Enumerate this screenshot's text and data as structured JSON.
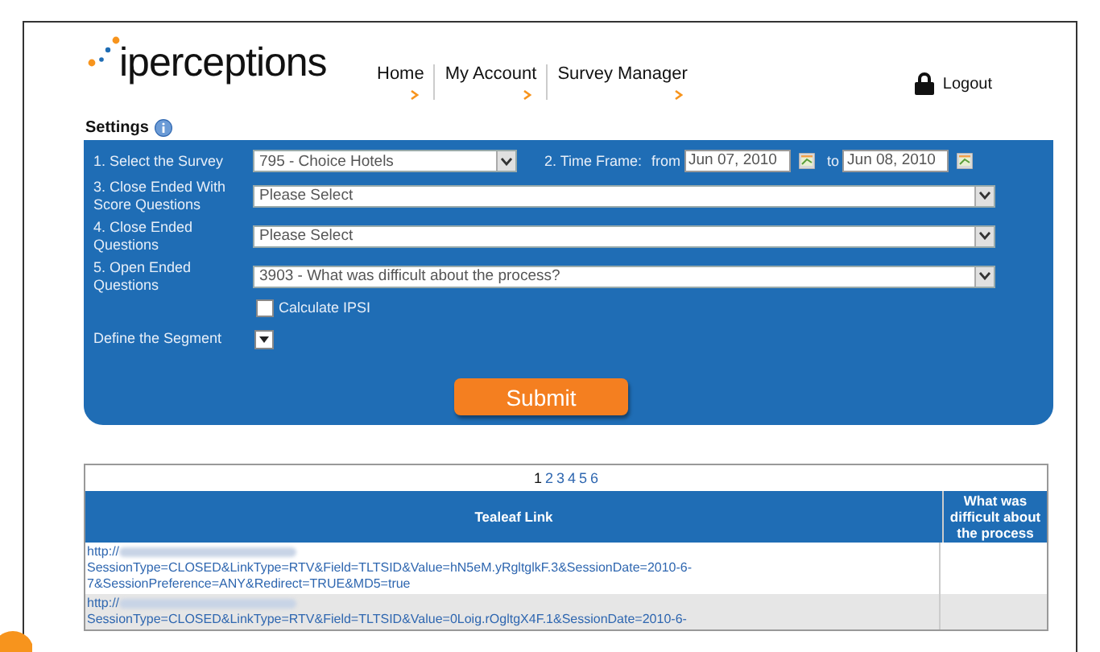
{
  "logo": {
    "text": "iperceptions"
  },
  "nav": [
    {
      "label": "Home"
    },
    {
      "label": "My Account"
    },
    {
      "label": "Survey Manager"
    }
  ],
  "logout": {
    "label": "Logout"
  },
  "settings": {
    "title": "Settings"
  },
  "form": {
    "survey_label": "1. Select the Survey",
    "survey_value": "795 - Choice Hotels",
    "time_frame_label": "2. Time Frame:",
    "from_label": "from",
    "from_value": "Jun 07, 2010",
    "to_label": "to",
    "to_value": "Jun 08, 2010",
    "selects": [
      {
        "label": "3. Close Ended With Score Questions",
        "value": "Please Select"
      },
      {
        "label": "4. Close Ended Questions",
        "value": "Please Select"
      },
      {
        "label": "5. Open Ended Questions",
        "value": "3903 - What was difficult about the process?"
      }
    ],
    "calculate_ipsi": {
      "label": "Calculate IPSI",
      "checked": false
    },
    "segment_label": "Define the Segment",
    "submit": "Submit"
  },
  "pagination": [
    {
      "label": "1",
      "selected": true
    },
    {
      "label": "2",
      "selected": false
    },
    {
      "label": "3",
      "selected": false
    },
    {
      "label": "4",
      "selected": false
    },
    {
      "label": "5",
      "selected": false
    },
    {
      "label": "6",
      "selected": false
    }
  ],
  "table": {
    "columns": [
      "Tealeaf Link",
      "What was difficult about the process"
    ],
    "rows": [
      {
        "link_lines": [
          "http://",
          "SessionType=CLOSED&LinkType=RTV&Field=TLTSID&Value=hN5eM.yRgltglkF.3&SessionDate=2010-6-",
          "7&SessionPreference=ANY&Redirect=TRUE&MD5=true"
        ],
        "redacted": true
      },
      {
        "link_lines": [
          "http://",
          "SessionType=CLOSED&LinkType=RTV&Field=TLTSID&Value=0Loig.rOgltgX4F.1&SessionDate=2010-6-"
        ],
        "redacted": true
      }
    ]
  }
}
